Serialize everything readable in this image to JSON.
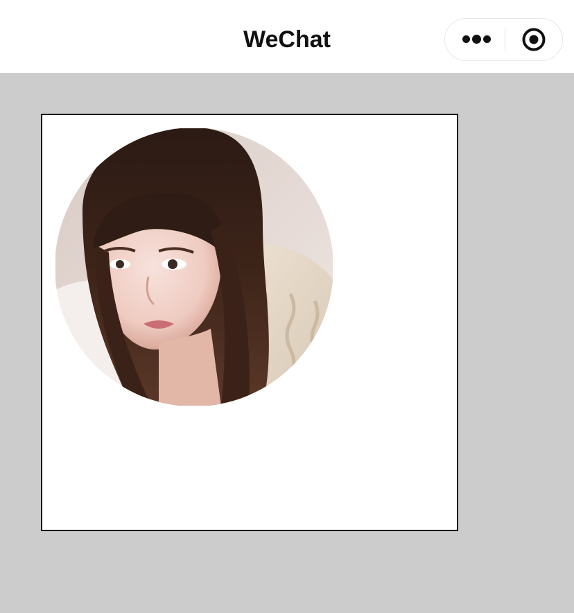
{
  "navbar": {
    "title": "WeChat",
    "menu_icon": "more-dots-icon",
    "close_icon": "target-circle-icon"
  },
  "colors": {
    "page_background": "#cccccc",
    "navbar_background": "#ffffff",
    "frame_border": "#000000"
  },
  "content": {
    "image_icon": "portrait-photo"
  }
}
